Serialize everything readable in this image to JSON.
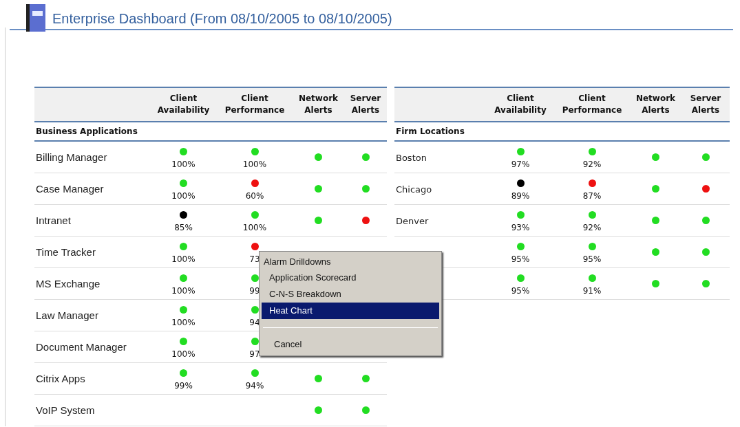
{
  "title": "Enterprise Dashboard (From 08/10/2005 to 08/10/2005)",
  "tables": [
    {
      "columns": [
        "Client Availability",
        "Client Performance",
        "Network Alerts",
        "Server Alerts"
      ],
      "section": "Business Applications",
      "rows": [
        {
          "name": "Billing Manager",
          "availability": {
            "color": "#22dd22",
            "value": "100%"
          },
          "performance": {
            "color": "#22dd22",
            "value": "100%"
          },
          "network": {
            "color": "#22dd22"
          },
          "server": {
            "color": "#22dd22"
          }
        },
        {
          "name": "Case Manager",
          "availability": {
            "color": "#22dd22",
            "value": "100%"
          },
          "performance": {
            "color": "#ee1111",
            "value": "60%"
          },
          "network": {
            "color": "#22dd22"
          },
          "server": {
            "color": "#22dd22"
          }
        },
        {
          "name": "Intranet",
          "availability": {
            "color": "#000000",
            "value": "85%"
          },
          "performance": {
            "color": "#22dd22",
            "value": "100%"
          },
          "network": {
            "color": "#22dd22"
          },
          "server": {
            "color": "#ee1111"
          }
        },
        {
          "name": "Time Tracker",
          "availability": {
            "color": "#22dd22",
            "value": "100%"
          },
          "performance": {
            "color": "#ee1111",
            "value": "73"
          }
        },
        {
          "name": "MS Exchange",
          "availability": {
            "color": "#22dd22",
            "value": "100%"
          },
          "performance": {
            "color": "#22dd22",
            "value": "99"
          }
        },
        {
          "name": "Law Manager",
          "availability": {
            "color": "#22dd22",
            "value": "100%"
          },
          "performance": {
            "color": "#22dd22",
            "value": "94"
          }
        },
        {
          "name": "Document Manager",
          "availability": {
            "color": "#22dd22",
            "value": "100%"
          },
          "performance": {
            "color": "#22dd22",
            "value": "97"
          }
        },
        {
          "name": "Citrix Apps",
          "availability": {
            "color": "#22dd22",
            "value": "99%"
          },
          "performance": {
            "color": "#22dd22",
            "value": "94%"
          },
          "network": {
            "color": "#22dd22"
          },
          "server": {
            "color": "#22dd22"
          }
        },
        {
          "name": "VoIP System",
          "network": {
            "color": "#22dd22"
          },
          "server": {
            "color": "#22dd22"
          }
        }
      ]
    },
    {
      "columns": [
        "Client Availability",
        "Client Performance",
        "Network Alerts",
        "Server Alerts"
      ],
      "section": "Firm Locations",
      "rows": [
        {
          "name": "Boston",
          "availability": {
            "color": "#22dd22",
            "value": "97%"
          },
          "performance": {
            "color": "#22dd22",
            "value": "92%"
          },
          "network": {
            "color": "#22dd22"
          },
          "server": {
            "color": "#22dd22"
          }
        },
        {
          "name": "Chicago",
          "availability": {
            "color": "#000000",
            "value": "89%"
          },
          "performance": {
            "color": "#ee1111",
            "value": "87%"
          },
          "network": {
            "color": "#22dd22"
          },
          "server": {
            "color": "#ee1111"
          }
        },
        {
          "name": "Denver",
          "availability": {
            "color": "#22dd22",
            "value": "93%"
          },
          "performance": {
            "color": "#22dd22",
            "value": "92%"
          },
          "network": {
            "color": "#22dd22"
          },
          "server": {
            "color": "#22dd22"
          }
        },
        {
          "availability": {
            "color": "#22dd22",
            "value": "95%"
          },
          "performance": {
            "color": "#22dd22",
            "value": "95%"
          },
          "network": {
            "color": "#22dd22"
          },
          "server": {
            "color": "#22dd22"
          }
        },
        {
          "availability": {
            "color": "#22dd22",
            "value": "95%"
          },
          "performance": {
            "color": "#22dd22",
            "value": "91%"
          },
          "network": {
            "color": "#22dd22"
          },
          "server": {
            "color": "#22dd22"
          }
        }
      ]
    }
  ],
  "menu": {
    "title": "Alarm Drilldowns",
    "items": [
      {
        "label": "Application Scorecard",
        "selected": false
      },
      {
        "label": "C-N-S Breakdown",
        "selected": false
      },
      {
        "label": "Heat Chart",
        "selected": true
      }
    ],
    "footer_items": [
      {
        "label": "Cancel",
        "selected": false
      }
    ]
  }
}
